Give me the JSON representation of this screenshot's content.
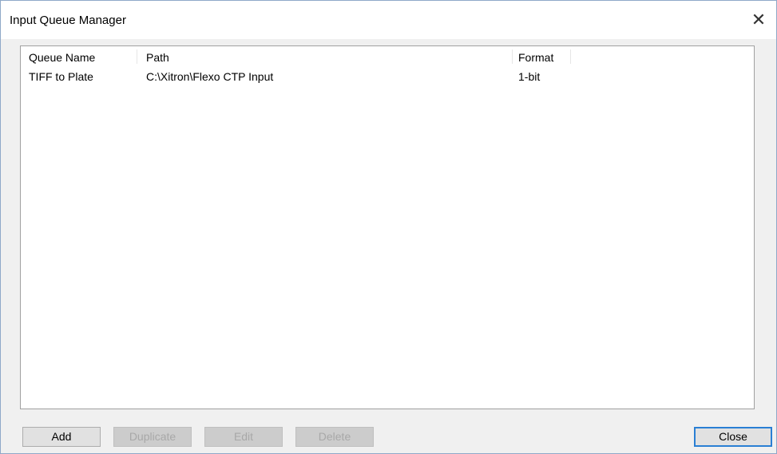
{
  "window": {
    "title": "Input Queue Manager",
    "close_glyph": "✕"
  },
  "queue_list": {
    "columns": [
      "Queue Name",
      "Path",
      "Format"
    ],
    "rows": [
      {
        "name": "TIFF to Plate",
        "path": "C:\\Xitron\\Flexo CTP Input",
        "format": "1-bit"
      }
    ]
  },
  "buttons": {
    "add": "Add",
    "duplicate": "Duplicate",
    "edit": "Edit",
    "delete": "Delete",
    "close": "Close"
  }
}
